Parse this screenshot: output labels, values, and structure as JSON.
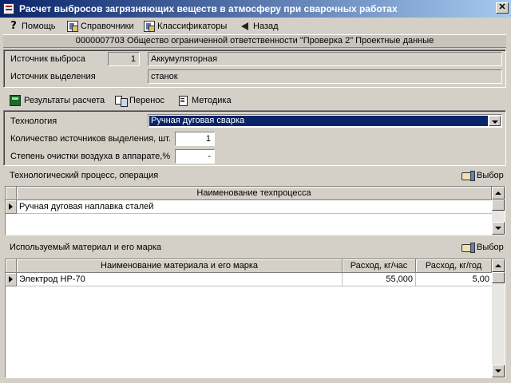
{
  "window": {
    "title": "Расчет выбросов загрязняющих веществ в атмосферу при сварочных работах",
    "close_glyph": "✕"
  },
  "menu": {
    "help": "Помощь",
    "references": "Справочники",
    "classifiers": "Классификаторы",
    "back": "Назад"
  },
  "info_line": "0000007703  Общество ограниченной ответственности \"Проверка 2\"   Проектные данные",
  "source": {
    "emission_label": "Источник выброса",
    "emission_number": "1",
    "emission_name": "Аккумуляторная",
    "release_label": "Источник выделения",
    "release_name": "станок"
  },
  "toolbar": {
    "results": "Результаты расчета",
    "transfer": "Перенос",
    "methodology": "Методика"
  },
  "params": {
    "technology_label": "Технология",
    "technology_value": "Ручная дуговая сварка",
    "count_label": "Количество источников выделения, шт.",
    "count_value": "1",
    "cleaning_label": "Степень очистки воздуха в аппарате,%",
    "cleaning_value": "-"
  },
  "process": {
    "title": "Технологический процесс, операция",
    "select_label": "Выбор",
    "column": "Наименование техпроцесса",
    "rows": [
      "Ручная дуговая наплавка сталей"
    ]
  },
  "materials": {
    "title": "Используемый материал и его марка",
    "select_label": "Выбор",
    "columns": [
      "Наименование материала и его марка",
      "Расход, кг/час",
      "Расход, кг/год"
    ],
    "rows": [
      {
        "name": "Электрод НР-70",
        "per_hour": "55,000",
        "per_year": "5,00"
      }
    ]
  }
}
